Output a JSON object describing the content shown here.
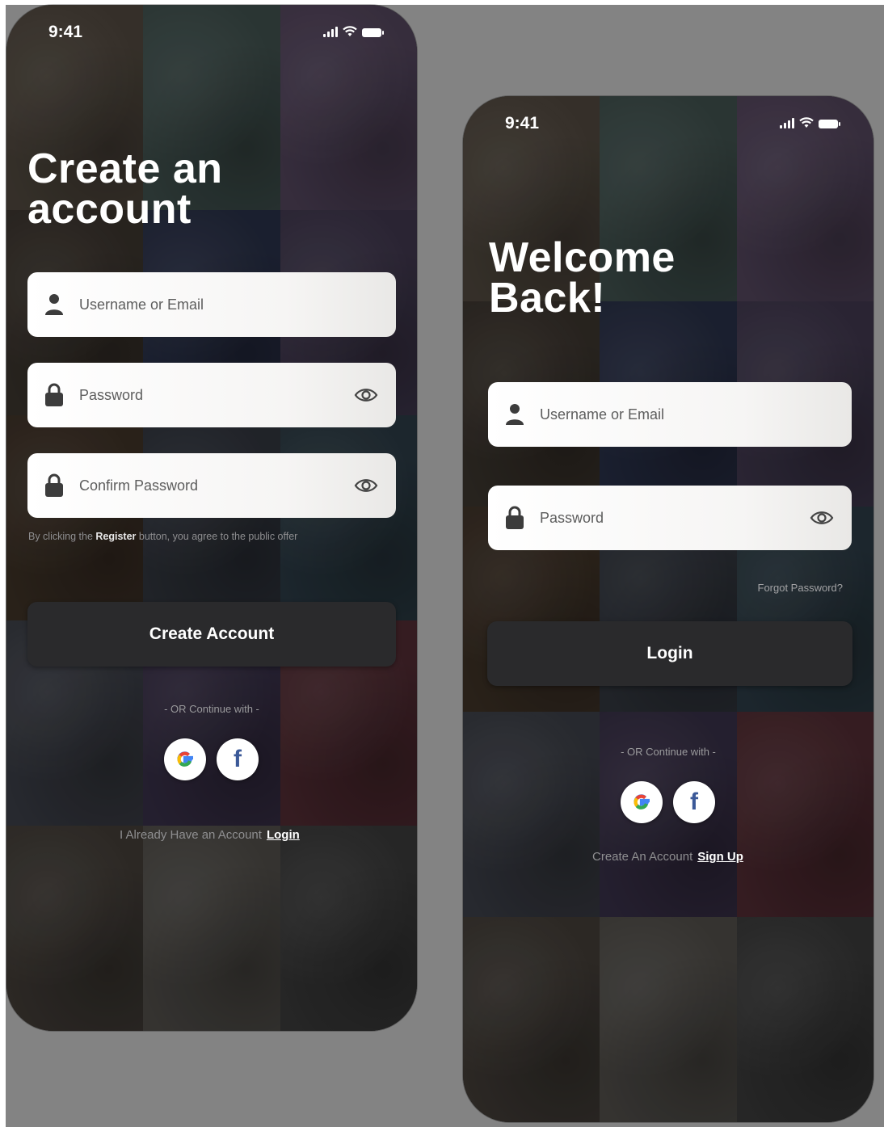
{
  "status_bar": {
    "time": "9:41",
    "signal_icon": "cellular-signal-icon",
    "wifi_icon": "wifi-icon",
    "battery_icon": "battery-icon"
  },
  "signup": {
    "title_line1": "Create an",
    "title_line2": "account",
    "username_placeholder": "Username or Email",
    "password_placeholder": "Password",
    "confirm_placeholder": "Confirm Password",
    "terms_prefix": "By clicking the",
    "terms_bold": "Register",
    "terms_suffix": "button, you agree to the public offer",
    "button_label": "Create Account",
    "or_text": "- OR Continue with -",
    "bottom_text": "I Already Have an Account",
    "bottom_link": "Login"
  },
  "login": {
    "title_line1": "Welcome",
    "title_line2": "Back!",
    "username_placeholder": "Username or Email",
    "password_placeholder": "Password",
    "forgot_link": "Forgot Password?",
    "button_label": "Login",
    "or_text": "- OR Continue with -",
    "bottom_text": "Create An Account",
    "bottom_link": "Sign Up"
  },
  "social": {
    "google_icon": "google-icon",
    "facebook_icon": "facebook-icon",
    "facebook_glyph": "f"
  },
  "colors": {
    "background": "#838383",
    "button": "#2a2a2c",
    "field": "#ffffff",
    "text": "#ffffff",
    "facebook": "#3b5998"
  }
}
